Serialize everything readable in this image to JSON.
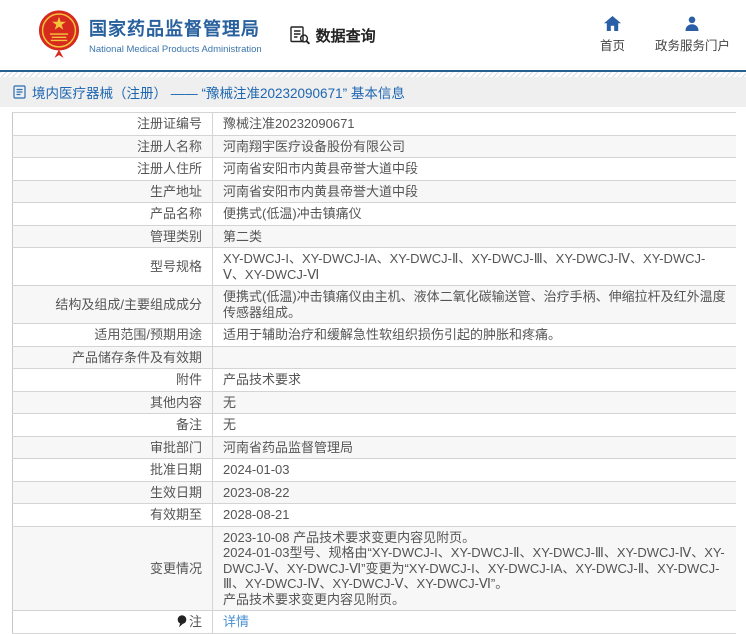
{
  "header": {
    "org_name_cn": "国家药品监督管理局",
    "org_name_en": "National Medical Products Administration",
    "nav_query": "数据查询",
    "nav_home": "首页",
    "nav_portal": "政务服务门户"
  },
  "breadcrumb": {
    "text": "境内医疗器械（注册） —— “豫械注准20232090671” 基本信息"
  },
  "table": {
    "rows": [
      {
        "label": "注册证编号",
        "value": "豫械注准20232090671"
      },
      {
        "label": "注册人名称",
        "value": "河南翔宇医疗设备股份有限公司"
      },
      {
        "label": "注册人住所",
        "value": "河南省安阳市内黄县帝誉大道中段"
      },
      {
        "label": "生产地址",
        "value": "河南省安阳市内黄县帝誉大道中段"
      },
      {
        "label": "产品名称",
        "value": "便携式(低温)冲击镇痛仪"
      },
      {
        "label": "管理类别",
        "value": "第二类"
      },
      {
        "label": "型号规格",
        "value": "XY-DWCJ-I、XY-DWCJ-IA、XY-DWCJ-Ⅱ、XY-DWCJ-Ⅲ、XY-DWCJ-Ⅳ、XY-DWCJ-Ⅴ、XY-DWCJ-Ⅵ"
      },
      {
        "label": "结构及组成/主要组成成分",
        "value": "便携式(低温)冲击镇痛仪由主机、液体二氧化碳输送管、治疗手柄、伸缩拉杆及红外温度传感器组成。"
      },
      {
        "label": "适用范围/预期用途",
        "value": "适用于辅助治疗和缓解急性软组织损伤引起的肿胀和疼痛。"
      },
      {
        "label": "产品储存条件及有效期",
        "value": ""
      },
      {
        "label": "附件",
        "value": "产品技术要求"
      },
      {
        "label": "其他内容",
        "value": "无"
      },
      {
        "label": "备注",
        "value": "无"
      },
      {
        "label": "审批部门",
        "value": "河南省药品监督管理局"
      },
      {
        "label": "批准日期",
        "value": "2024-01-03"
      },
      {
        "label": "生效日期",
        "value": "2023-08-22"
      },
      {
        "label": "有效期至",
        "value": "2028-08-21"
      },
      {
        "label": "变更情况",
        "value": "2023-10-08 产品技术要求变更内容见附页。\n2024-01-03型号、规格由“XY-DWCJ-I、XY-DWCJ-Ⅱ、XY-DWCJ-Ⅲ、XY-DWCJ-Ⅳ、XY-DWCJ-Ⅴ、XY-DWCJ-Ⅵ”变更为“XY-DWCJ-I、XY-DWCJ-IA、XY-DWCJ-Ⅱ、XY-DWCJ-Ⅲ、XY-DWCJ-Ⅳ、XY-DWCJ-Ⅴ、XY-DWCJ-Ⅵ”。\n产品技术要求变更内容见附页。",
        "multiline": true
      },
      {
        "label": "注",
        "value": "详情",
        "link": true,
        "icon": "note-icon"
      }
    ]
  },
  "icons": {
    "emblem": "national-emblem-icon",
    "query": "document-magnifier-icon",
    "home": "house-icon",
    "portal": "person-icon",
    "breadcrumb": "document-icon",
    "note": "balloon-note-icon"
  },
  "colors": {
    "brand_blue": "#29619e",
    "nav_icon_blue": "#2a5fa5",
    "link_blue": "#4a90d2",
    "breadcrumb_text": "#1d66b1",
    "emblem_red": "#d62a1f",
    "emblem_gold": "#f5c43c",
    "breadcrumb_bg": "#efefef",
    "row_alt_bg": "#f7f7f7",
    "border": "#d4d4d4",
    "text": "#555555",
    "header_line": "#26618f"
  }
}
